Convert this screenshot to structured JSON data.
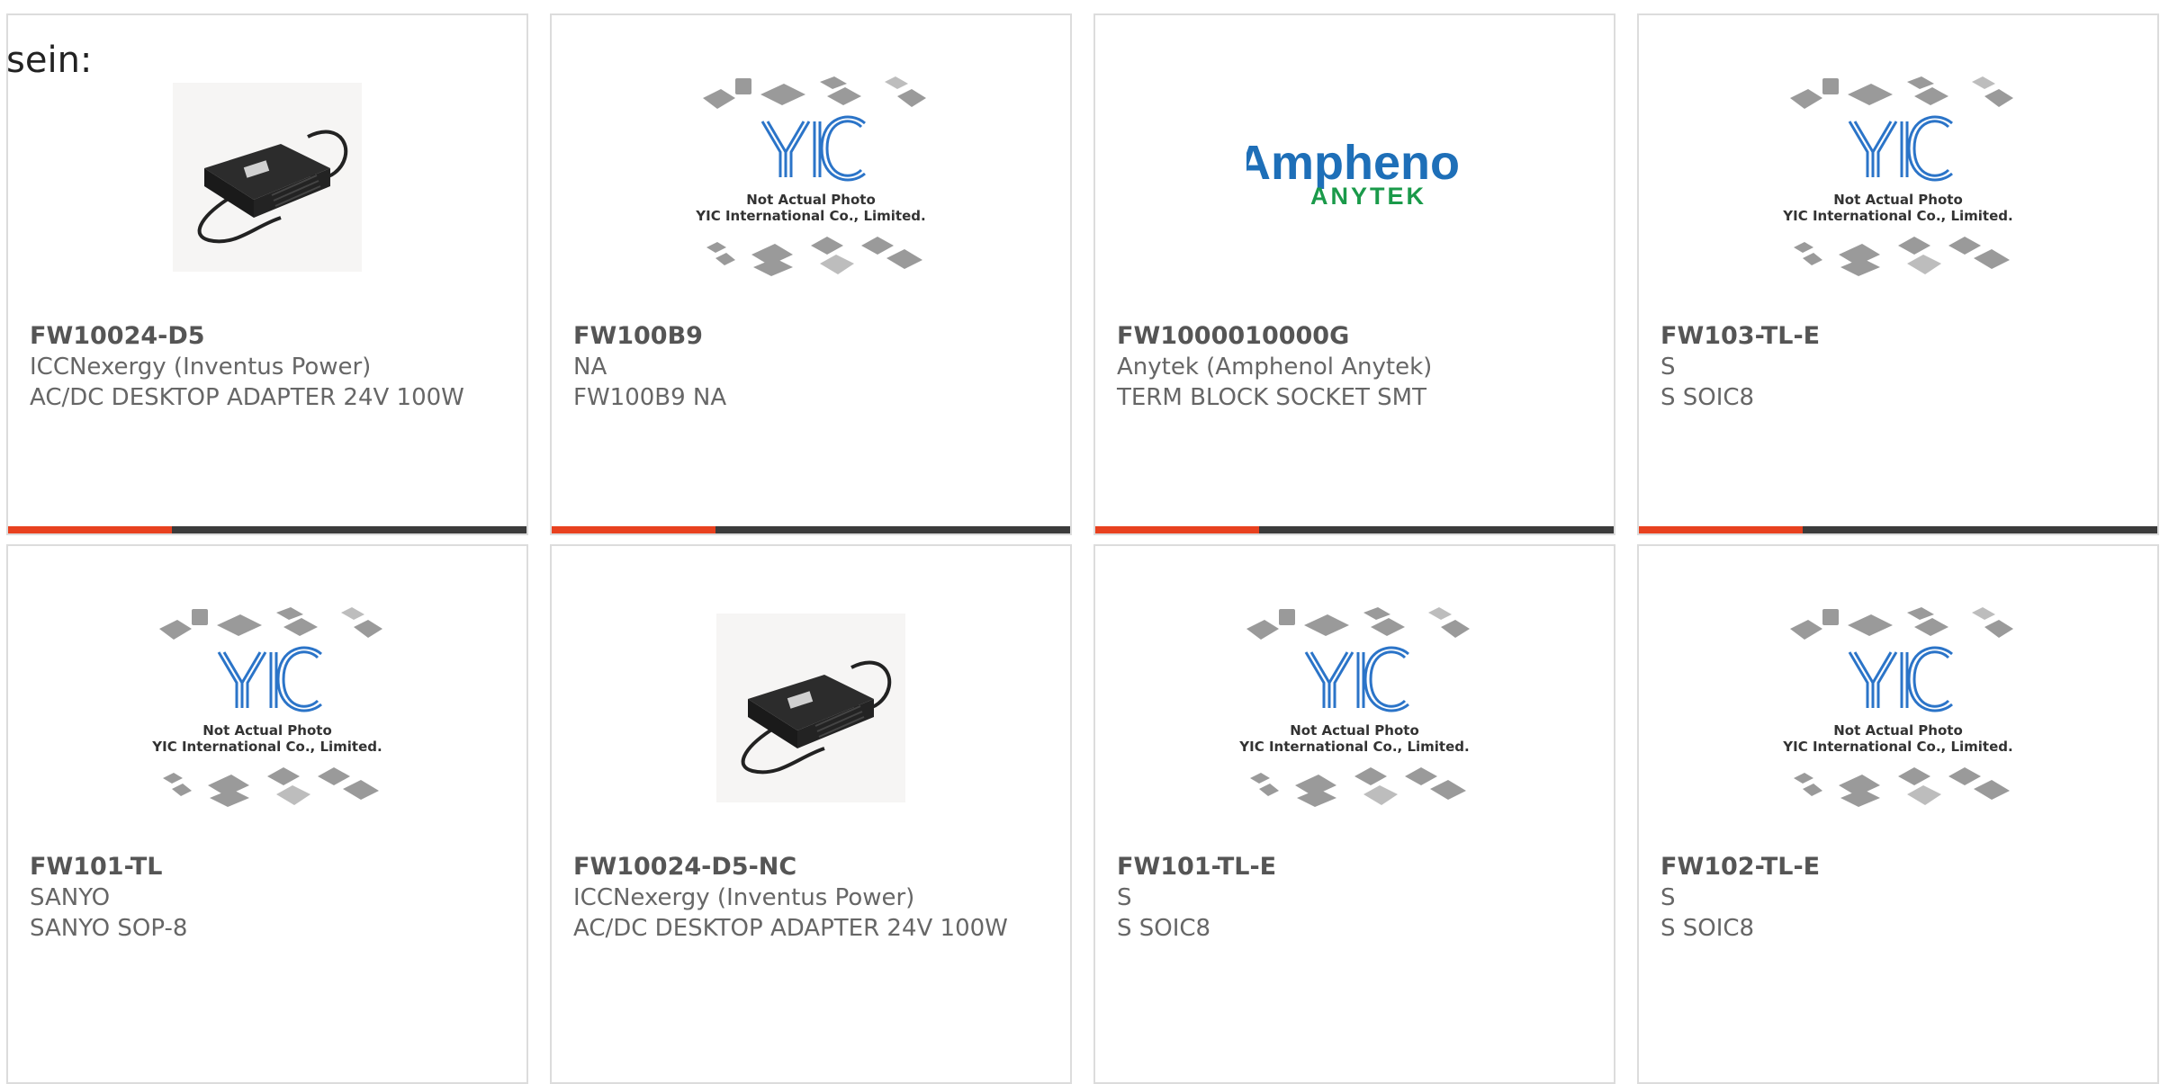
{
  "header_fragment": "sein:",
  "colors": {
    "accent": "#e8411f",
    "bar": "#3b3b3b",
    "border": "#dcdcdc",
    "text": "#666666"
  },
  "products": [
    {
      "part": "FW10024-D5",
      "brand": "ICCNexergy (Inventus Power)",
      "desc": "AC/DC DESKTOP ADAPTER 24V 100W",
      "image": "adapter-photo"
    },
    {
      "part": "FW100B9",
      "brand": "NA",
      "desc": "FW100B9 NA",
      "image": "yic-placeholder"
    },
    {
      "part": "FW1000010000G",
      "brand": "Anytek (Amphenol Anytek)",
      "desc": "TERM BLOCK SOCKET SMT",
      "image": "amphenol-anytek-logo"
    },
    {
      "part": "FW103-TL-E",
      "brand": "S",
      "desc": "S SOIC8",
      "image": "yic-placeholder"
    },
    {
      "part": "FW101-TL",
      "brand": "SANYO",
      "desc": "SANYO SOP-8",
      "image": "yic-placeholder"
    },
    {
      "part": "FW10024-D5-NC",
      "brand": "ICCNexergy (Inventus Power)",
      "desc": "AC/DC DESKTOP ADAPTER 24V 100W",
      "image": "adapter-photo"
    },
    {
      "part": "FW101-TL-E",
      "brand": "S",
      "desc": "S SOIC8",
      "image": "yic-placeholder"
    },
    {
      "part": "FW102-TL-E",
      "brand": "S",
      "desc": "S SOIC8",
      "image": "yic-placeholder"
    }
  ],
  "yic": {
    "line1": "Not Actual Photo",
    "line2": "YIC International Co., Limited."
  },
  "amphenol": {
    "word": "Amphenol",
    "sub": "ANYTEK"
  }
}
